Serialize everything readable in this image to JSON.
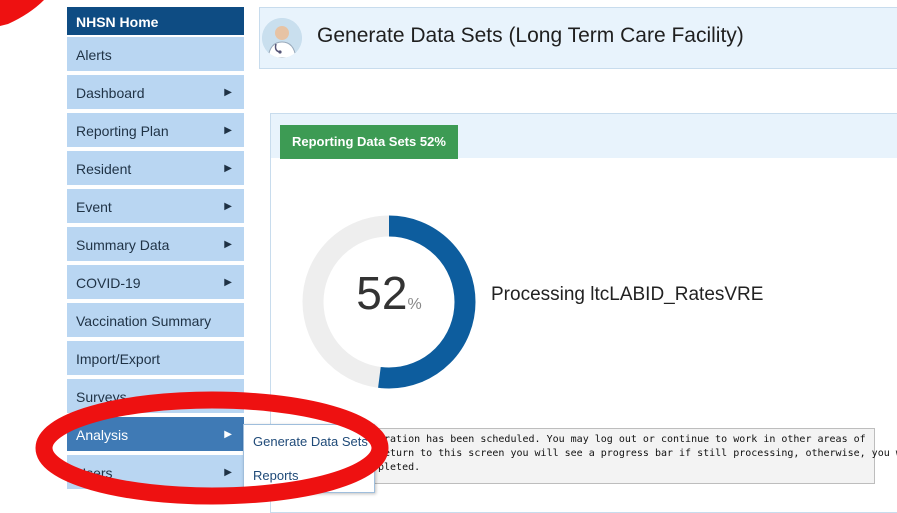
{
  "sidebar": {
    "home_label": "NHSN Home",
    "items": [
      {
        "label": "Alerts",
        "has_submenu": false
      },
      {
        "label": "Dashboard",
        "has_submenu": true
      },
      {
        "label": "Reporting Plan",
        "has_submenu": true
      },
      {
        "label": "Resident",
        "has_submenu": true
      },
      {
        "label": "Event",
        "has_submenu": true
      },
      {
        "label": "Summary Data",
        "has_submenu": true
      },
      {
        "label": "COVID-19",
        "has_submenu": true
      },
      {
        "label": "Vaccination Summary",
        "has_submenu": false
      },
      {
        "label": "Import/Export",
        "has_submenu": false
      },
      {
        "label": "Surveys",
        "has_submenu": true
      },
      {
        "label": "Analysis",
        "has_submenu": true,
        "active": true
      },
      {
        "label": "Users",
        "has_submenu": true
      }
    ],
    "arrow_glyph": "▶"
  },
  "flyout": {
    "items": [
      "Generate Data Sets",
      "Reports"
    ]
  },
  "header": {
    "title": "Generate Data Sets (Long Term Care Facility)",
    "icon": "doctor-avatar-icon"
  },
  "panel": {
    "tab_label": "Reporting Data Sets 52%",
    "progress_value": 52,
    "percent_sign": "%",
    "processing_text": "Processing ltcLABID_RatesVRE",
    "notice_lines": [
      "eration has been scheduled. You may log out or continue to work in other areas of",
      "return to this screen you will see a progress bar if still processing, otherwise, you will",
      "pleted."
    ]
  },
  "colors": {
    "nav_bg": "#b9d6f2",
    "nav_home_bg": "#0e4c83",
    "nav_active_bg": "#3f7ab5",
    "tab_green": "#3d9b54",
    "ring_fill": "#0d5d9e",
    "ring_track": "#eeeeee",
    "annotation_red": "#ee1111"
  }
}
